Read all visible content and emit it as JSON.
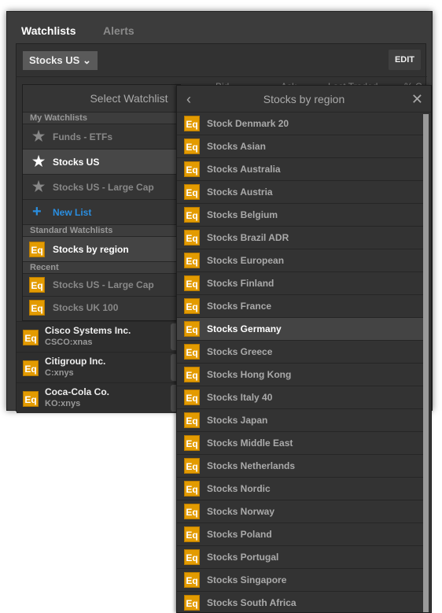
{
  "tabs": [
    {
      "label": "Watchlists",
      "active": true
    },
    {
      "label": "Alerts",
      "active": false
    }
  ],
  "toolbar": {
    "selected_list": "Stocks US",
    "edit_label": "EDIT"
  },
  "columns": [
    "Bid",
    "Ask",
    "Last Traded",
    "% C"
  ],
  "stocks": [
    {
      "name": "Cisco Systems Inc.",
      "symbol": "CSCO:xnas"
    },
    {
      "name": "Citigroup Inc.",
      "symbol": "C:xnys"
    },
    {
      "name": "Coca-Cola Co.",
      "symbol": "KO:xnys"
    }
  ],
  "select_popup": {
    "title": "Select Watchlist",
    "my_heading": "My Watchlists",
    "my_items": [
      {
        "label": "Funds - ETFs",
        "active": false
      },
      {
        "label": "Stocks US",
        "active": true
      },
      {
        "label": "Stocks US - Large Cap",
        "active": false
      }
    ],
    "new_list": "New List",
    "standard_heading": "Standard Watchlists",
    "standard_items": [
      {
        "label": "Stocks by region"
      }
    ],
    "recent_heading": "Recent",
    "recent_items": [
      {
        "label": "Stocks US - Large Cap"
      },
      {
        "label": "Stocks UK 100"
      }
    ]
  },
  "region_popup": {
    "title": "Stocks by region",
    "selected": "Stocks Germany",
    "items": [
      "Stock Denmark 20",
      "Stocks Asian",
      "Stocks Australia",
      "Stocks Austria",
      "Stocks Belgium",
      "Stocks Brazil ADR",
      "Stocks European",
      "Stocks Finland",
      "Stocks France",
      "Stocks Germany",
      "Stocks Greece",
      "Stocks Hong Kong",
      "Stocks Italy 40",
      "Stocks Japan",
      "Stocks Middle East",
      "Stocks Netherlands",
      "Stocks Nordic",
      "Stocks Norway",
      "Stocks Poland",
      "Stocks Portugal",
      "Stocks Singapore",
      "Stocks South Africa"
    ]
  },
  "badge": "Eq",
  "colors": {
    "accent": "#e39b00",
    "link": "#2a8ee0"
  }
}
